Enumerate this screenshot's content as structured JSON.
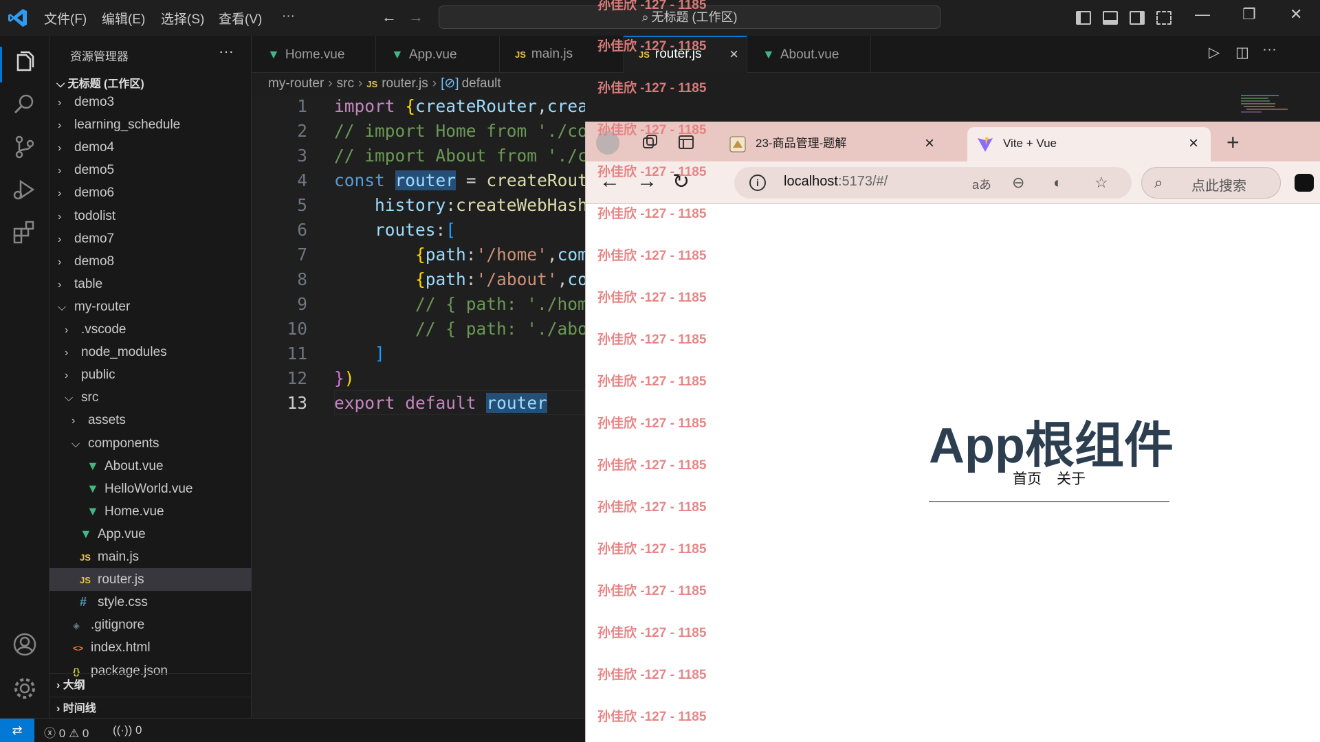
{
  "titlebar": {
    "menus": [
      "文件(F)",
      "编辑(E)",
      "选择(S)",
      "查看(V)",
      "···"
    ],
    "command_center": "无标题 (工作区)",
    "back_icon": "arrow-left-icon",
    "forward_icon": "arrow-right-icon"
  },
  "sidebar": {
    "title": "资源管理器",
    "more": "···",
    "workspace": "无标题 (工作区)",
    "tree": [
      {
        "label": "demo3",
        "type": "folder",
        "depth": 0,
        "expanded": false
      },
      {
        "label": "learning_schedule",
        "type": "folder",
        "depth": 0,
        "expanded": false
      },
      {
        "label": "demo4",
        "type": "folder",
        "depth": 0,
        "expanded": false
      },
      {
        "label": "demo5",
        "type": "folder",
        "depth": 0,
        "expanded": false
      },
      {
        "label": "demo6",
        "type": "folder",
        "depth": 0,
        "expanded": false
      },
      {
        "label": "todolist",
        "type": "folder",
        "depth": 0,
        "expanded": false
      },
      {
        "label": "demo7",
        "type": "folder",
        "depth": 0,
        "expanded": false
      },
      {
        "label": "demo8",
        "type": "folder",
        "depth": 0,
        "expanded": false
      },
      {
        "label": "table",
        "type": "folder",
        "depth": 0,
        "expanded": false
      },
      {
        "label": "my-router",
        "type": "folder",
        "depth": 0,
        "expanded": true
      },
      {
        "label": ".vscode",
        "type": "folder",
        "depth": 1,
        "expanded": false
      },
      {
        "label": "node_modules",
        "type": "folder",
        "depth": 1,
        "expanded": false
      },
      {
        "label": "public",
        "type": "folder",
        "depth": 1,
        "expanded": false
      },
      {
        "label": "src",
        "type": "folder",
        "depth": 1,
        "expanded": true
      },
      {
        "label": "assets",
        "type": "folder",
        "depth": 2,
        "expanded": false
      },
      {
        "label": "components",
        "type": "folder",
        "depth": 2,
        "expanded": true
      },
      {
        "label": "About.vue",
        "type": "vue",
        "depth": 3
      },
      {
        "label": "HelloWorld.vue",
        "type": "vue",
        "depth": 3
      },
      {
        "label": "Home.vue",
        "type": "vue",
        "depth": 3
      },
      {
        "label": "App.vue",
        "type": "vue",
        "depth": 2
      },
      {
        "label": "main.js",
        "type": "js",
        "depth": 2
      },
      {
        "label": "router.js",
        "type": "js",
        "depth": 2,
        "selected": true
      },
      {
        "label": "style.css",
        "type": "css",
        "depth": 2
      },
      {
        "label": ".gitignore",
        "type": "git",
        "depth": 1
      },
      {
        "label": "index.html",
        "type": "html",
        "depth": 1
      },
      {
        "label": "package.json",
        "type": "json",
        "depth": 1
      }
    ],
    "outline": "大纲",
    "timeline": "时间线"
  },
  "tabs": [
    {
      "label": "Home.vue",
      "type": "vue"
    },
    {
      "label": "App.vue",
      "type": "vue"
    },
    {
      "label": "main.js",
      "type": "js"
    },
    {
      "label": "router.js",
      "type": "js",
      "active": true
    },
    {
      "label": "About.vue",
      "type": "vue"
    }
  ],
  "breadcrumb": {
    "parts": [
      "my-router",
      "src",
      "router.js",
      "default"
    ],
    "js_badge": "JS"
  },
  "icons": {
    "vue": "▼",
    "js": "JS",
    "css": "#",
    "git": "◈",
    "html": "<>",
    "json": "{}",
    "close": "×"
  },
  "editor": {
    "line_numbers": [
      "1",
      "2",
      "3",
      "4",
      "5",
      "6",
      "7",
      "8",
      "9",
      "10",
      "11",
      "12",
      "13"
    ],
    "current_line": "13"
  },
  "statusbar": {
    "errors": "0",
    "warnings": "0",
    "ports": "0"
  },
  "browser": {
    "tab1_title": "23-商品管理-题解",
    "tab2_title": "Vite + Vue",
    "url_host": "localhost",
    "url_rest": ":5173/#/",
    "translate_icon": "aあ",
    "search_placeholder": "点此搜索",
    "page": {
      "heading": "App根组件",
      "nav_home": "首页",
      "nav_about": "关于"
    }
  },
  "watermark": "孙佳欣 -127 - 1185",
  "colors": {
    "accent": "#0078d4",
    "vue_green": "#41b883",
    "js_yellow": "#e8c44a",
    "heading": "#2c3e50",
    "watermark": "#e57f7f"
  }
}
